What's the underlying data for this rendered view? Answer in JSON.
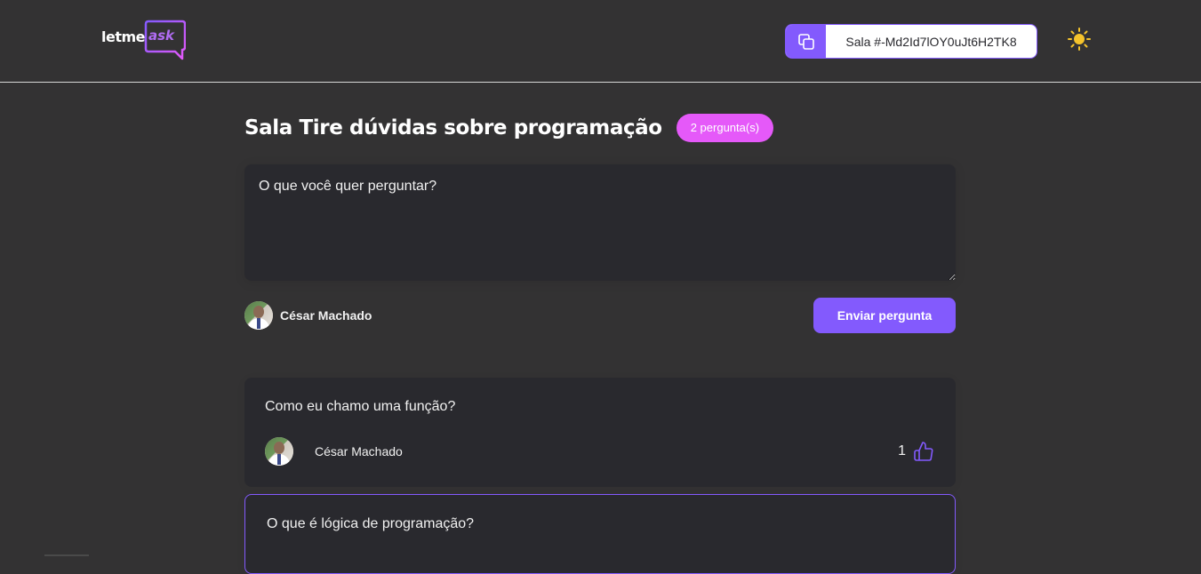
{
  "header": {
    "logo": {
      "text_main": "letme",
      "text_accent": "ask"
    },
    "room_code": {
      "label": "Sala #-Md2Id7lOY0uJt6H2TK8"
    },
    "theme_icon": "sun-icon"
  },
  "room": {
    "title": "Sala Tire dúvidas sobre programação",
    "question_count": "2 pergunta(s)"
  },
  "form": {
    "placeholder": "O que você quer perguntar?",
    "user_name": "César Machado",
    "submit_label": "Enviar pergunta"
  },
  "questions": [
    {
      "content": "Como eu chamo uma função?",
      "author": "César Machado",
      "like_count": "1"
    },
    {
      "content": "O que é lógica de programação?"
    }
  ],
  "colors": {
    "background": "#333233",
    "surface": "#29292e",
    "accent": "#835afd",
    "badge": "#e559f9",
    "sun": "#f5c32c"
  }
}
